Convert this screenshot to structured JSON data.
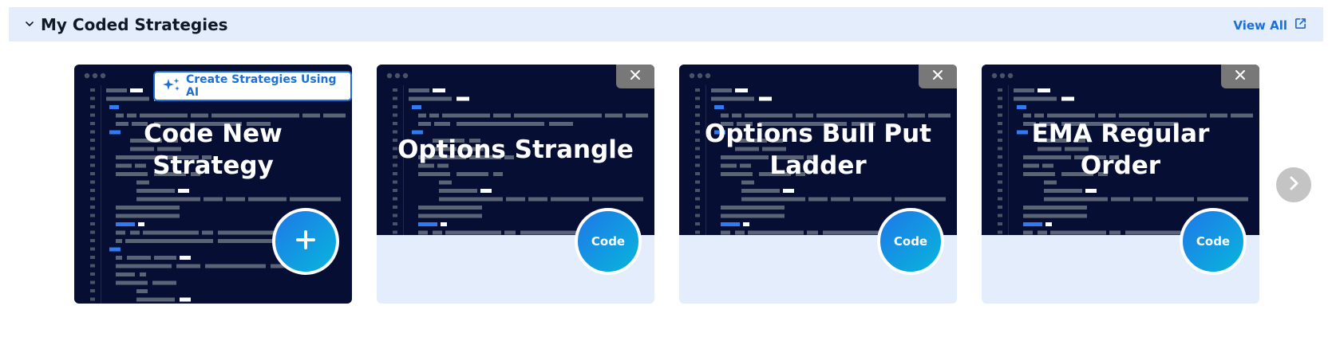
{
  "section": {
    "title": "My Coded Strategies",
    "view_all_label": "View All"
  },
  "cards": [
    {
      "title": "Code New Strategy",
      "ai_button_label": "Create Strategies Using AI"
    },
    {
      "title": "Options Strangle",
      "code_label": "Code"
    },
    {
      "title": "Options Bull Put Ladder",
      "code_label": "Code"
    },
    {
      "title": "EMA Regular Order",
      "code_label": "Code"
    }
  ],
  "icons": {
    "collapse": "chevron-down-icon",
    "view_all": "external-link-icon",
    "close": "close-icon",
    "add": "plus-icon",
    "ai": "sparkles-icon",
    "next": "chevron-right-icon"
  },
  "colors": {
    "header_bg": "#e3edfc",
    "card_dark_bg": "#060e33",
    "accent_blue": "#1c6fd6",
    "gradient_start": "#1e78e8",
    "gradient_end": "#08b6dc",
    "close_bg": "#787878"
  }
}
